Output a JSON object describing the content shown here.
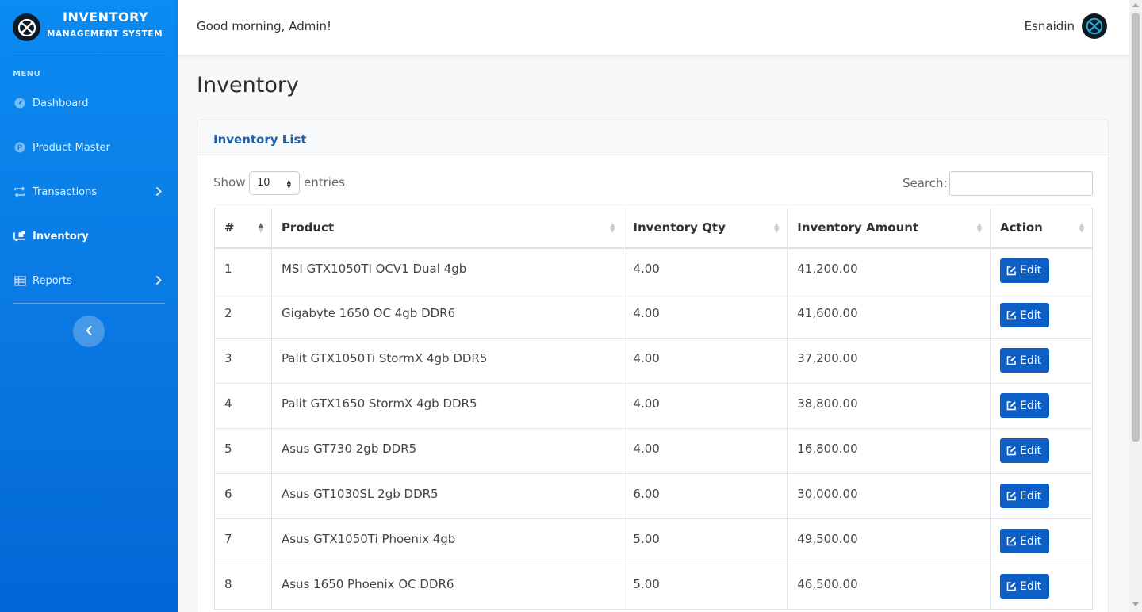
{
  "brand": {
    "title_line1": "INVENTORY",
    "title_line2": "MANAGEMENT SYSTEM",
    "logo_icon": "celtic-knot-logo"
  },
  "sidebar": {
    "menu_heading": "MENU",
    "items": [
      {
        "label": "Dashboard",
        "icon": "dashboard-gauge-icon",
        "has_submenu": false,
        "active": false
      },
      {
        "label": "Product Master",
        "icon": "product-p-icon",
        "has_submenu": false,
        "active": false
      },
      {
        "label": "Transactions",
        "icon": "transfer-arrows-icon",
        "has_submenu": true,
        "active": false
      },
      {
        "label": "Inventory",
        "icon": "truck-loading-icon",
        "has_submenu": false,
        "active": true
      },
      {
        "label": "Reports",
        "icon": "table-grid-icon",
        "has_submenu": true,
        "active": false
      }
    ],
    "collapse_icon": "chevron-left-icon"
  },
  "topbar": {
    "greeting": "Good morning, Admin!",
    "user_name": "Esnaidin"
  },
  "page": {
    "title": "Inventory"
  },
  "card": {
    "title": "Inventory List"
  },
  "table_controls": {
    "show_label": "Show",
    "entries_value": "10",
    "entries_label": "entries",
    "search_label": "Search:",
    "search_value": ""
  },
  "table": {
    "columns": [
      "#",
      "Product",
      "Inventory Qty",
      "Inventory Amount",
      "Action"
    ],
    "sorted_column": "#",
    "action_label": "Edit",
    "rows": [
      {
        "no": "1",
        "product": "MSI GTX1050TI OCV1 Dual 4gb",
        "qty": "4.00",
        "amount": "41,200.00"
      },
      {
        "no": "2",
        "product": "Gigabyte 1650 OC 4gb DDR6",
        "qty": "4.00",
        "amount": "41,600.00"
      },
      {
        "no": "3",
        "product": "Palit GTX1050Ti StormX 4gb DDR5",
        "qty": "4.00",
        "amount": "37,200.00"
      },
      {
        "no": "4",
        "product": "Palit GTX1650 StormX 4gb DDR5",
        "qty": "4.00",
        "amount": "38,800.00"
      },
      {
        "no": "5",
        "product": "Asus GT730 2gb DDR5",
        "qty": "4.00",
        "amount": "16,800.00"
      },
      {
        "no": "6",
        "product": "Asus GT1030SL 2gb DDR5",
        "qty": "6.00",
        "amount": "30,000.00"
      },
      {
        "no": "7",
        "product": "Asus GTX1050Ti Phoenix 4gb",
        "qty": "5.00",
        "amount": "49,500.00"
      },
      {
        "no": "8",
        "product": "Asus 1650 Phoenix OC DDR6",
        "qty": "5.00",
        "amount": "46,500.00"
      }
    ]
  },
  "colors": {
    "sidebar": "#0a7fe8",
    "accent": "#0d5fc5",
    "card_title": "#1f5ea8"
  }
}
